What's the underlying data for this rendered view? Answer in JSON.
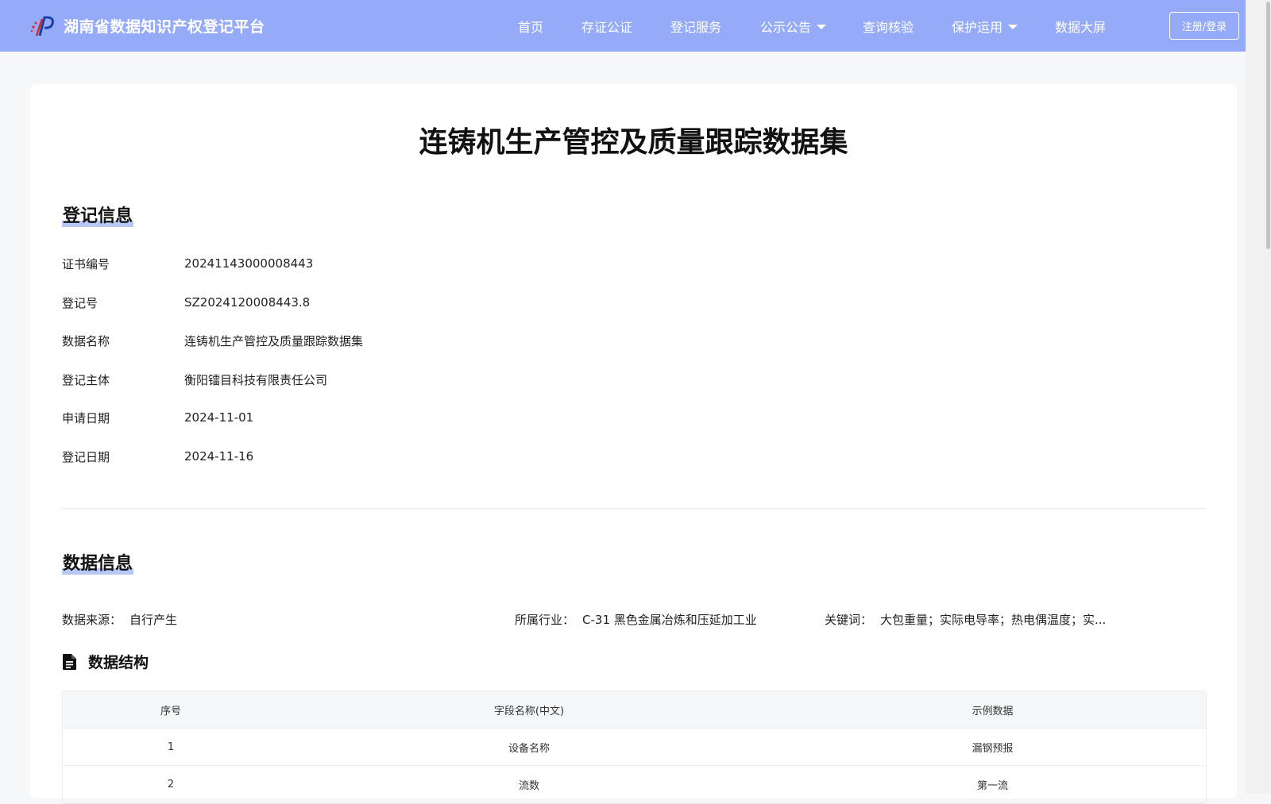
{
  "header": {
    "brand_name": "湖南省数据知识产权登记平台",
    "nav": [
      "首页",
      "存证公证",
      "登记服务",
      "公示公告",
      "查询核验",
      "保护运用",
      "数据大屏"
    ],
    "login_label": "注册/登录"
  },
  "page": {
    "title": "连铸机生产管控及质量跟踪数据集"
  },
  "registration": {
    "section_title": "登记信息",
    "rows": [
      {
        "label": "证书编号",
        "value": "20241143000008443"
      },
      {
        "label": "登记号",
        "value": "SZ2024120008443.8"
      },
      {
        "label": "数据名称",
        "value": "连铸机生产管控及质量跟踪数据集"
      },
      {
        "label": "登记主体",
        "value": "衡阳镭目科技有限责任公司"
      },
      {
        "label": "申请日期",
        "value": "2024-11-01"
      },
      {
        "label": "登记日期",
        "value": "2024-11-16"
      }
    ]
  },
  "data_info": {
    "section_title": "数据信息",
    "source_label": "数据来源：",
    "source_value": "自行产生",
    "industry_label": "所属行业：",
    "industry_value": "C-31 黑色金属冶炼和压延加工业",
    "keywords_label": "关键词：",
    "keywords_value": "大包重量；实际电导率；热电偶温度；实..."
  },
  "structure": {
    "title": "数据结构",
    "columns": [
      "序号",
      "字段名称(中文)",
      "示例数据"
    ],
    "rows": [
      [
        "1",
        "设备名称",
        "漏钢预报"
      ],
      [
        "2",
        "流数",
        "第一流"
      ]
    ]
  },
  "colors": {
    "header_bg": "#96abf8",
    "section_highlight": "#b9c7f7"
  }
}
